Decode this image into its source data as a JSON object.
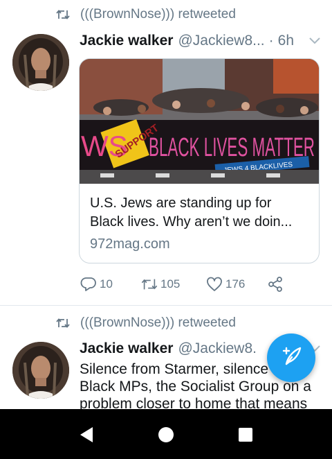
{
  "colors": {
    "accent": "#1da1f2",
    "muted": "#657786",
    "text": "#14171a",
    "divider": "#e1e8ed",
    "nav_bg": "#000000"
  },
  "tweets": [
    {
      "retweeted_by": "(((BrownNose))) retweeted",
      "author_name": "Jackie walker",
      "author_handle": "@Jackiew8...",
      "separator": "·",
      "time": "6h",
      "card": {
        "image_banner_text": "BLACK LIVES MATTER",
        "image_badge_text": "SUPPORT",
        "image_ws_text": "WS",
        "image_sub_banner_text": "JEWS 4 BLACKLIVES",
        "title_line1": "U.S. Jews are standing up for",
        "title_line2": "Black lives. Why aren’t we doin...",
        "domain": "972mag.com"
      },
      "actions": {
        "replies": "10",
        "retweets": "105",
        "likes": "176"
      }
    },
    {
      "retweeted_by": "(((BrownNose))) retweeted",
      "author_name": "Jackie walker",
      "author_handle": "@Jackiew8.",
      "text_lines": [
        "Silence from Starmer, silence from",
        "Black MPs, the Socialist Group on a",
        "problem closer to home that means"
      ]
    }
  ],
  "icons": {
    "retweet": "retweet-icon",
    "chevron": "chevron-down-icon",
    "reply": "reply-icon",
    "like": "heart-icon",
    "share": "share-icon",
    "compose": "compose-tweet-icon",
    "nav_back": "back-triangle-icon",
    "nav_home": "home-circle-icon",
    "nav_recents": "recents-square-icon"
  }
}
